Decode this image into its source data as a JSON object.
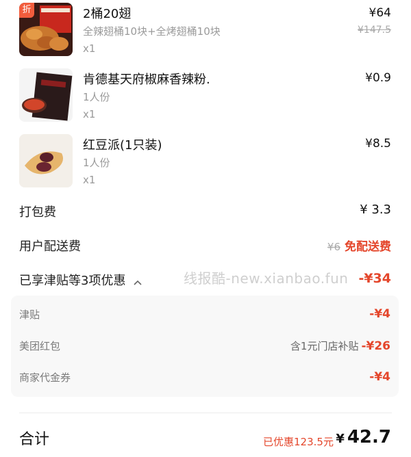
{
  "items": [
    {
      "badge": "折",
      "name": "2桶20翅",
      "desc": "全辣翅桶10块+全烤翅桶10块",
      "qty": "x1",
      "price": "¥64",
      "original_price": "¥147.5"
    },
    {
      "name": "肯德基天府椒麻香辣粉.",
      "desc": "1人份",
      "qty": "x1",
      "price": "¥0.9"
    },
    {
      "name": "红豆派(1只装)",
      "desc": "1人份",
      "qty": "x1",
      "price": "¥8.5"
    }
  ],
  "packing_fee": {
    "label": "打包费",
    "value": "¥ 3.3"
  },
  "delivery_fee": {
    "label": "用户配送费",
    "original": "¥6",
    "value": "免配送费"
  },
  "discount_summary": {
    "label": "已享津贴等3项优惠",
    "value": "-¥34"
  },
  "discount_details": [
    {
      "label": "津贴",
      "note": "",
      "value": "-¥4"
    },
    {
      "label": "美团红包",
      "note": "含1元门店补贴",
      "value": "-¥26"
    },
    {
      "label": "商家代金券",
      "note": "",
      "value": "-¥4"
    }
  ],
  "watermark": "线报酷-new.xianbao.fun",
  "total": {
    "label": "合计",
    "saved": "已优惠123.5元",
    "currency": "¥",
    "amount": "42.7"
  },
  "colors": {
    "accent": "#e4462b",
    "badge": "#f25d3d"
  }
}
